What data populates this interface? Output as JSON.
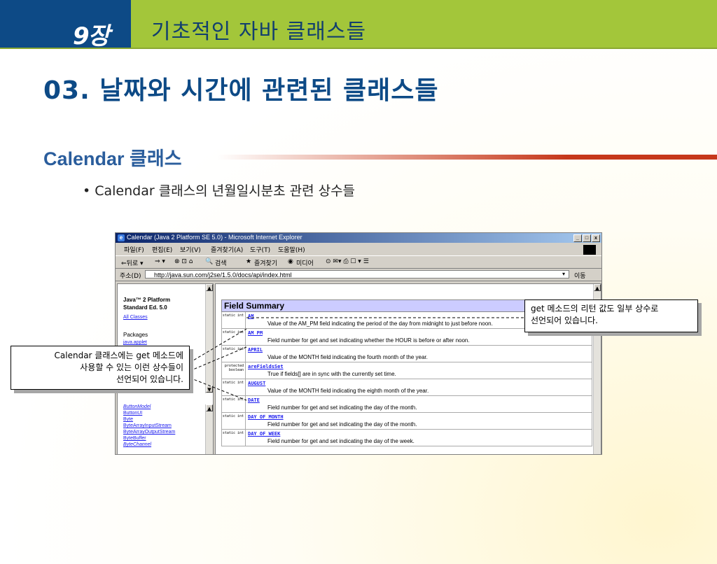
{
  "header": {
    "chapter_num": "9장",
    "chapter_title": "기초적인 자바 클래스들"
  },
  "slide": {
    "title": "03. 날짜와 시간에 관련된 클래스들",
    "subtitle": "Calendar 클래스",
    "bullet": "• Calendar 클래스의 년월일시분초 관련 상수들"
  },
  "browser": {
    "title": "Calendar (Java 2 Platform SE 5.0) - Microsoft Internet Explorer",
    "menu": [
      "파일(F)",
      "편집(E)",
      "보기(V)",
      "즐겨찾기(A)",
      "도구(T)",
      "도움말(H)"
    ],
    "toolbar": {
      "back": "⇐뒤로 ▾",
      "fwd": "⇒ ▾",
      "search": "검색",
      "favorites": "즐겨찾기",
      "media": "미디어"
    },
    "address_label": "주소(D)",
    "address_value": "http://java.sun.com/j2se/1.5.0/docs/api/index.html",
    "go_label": "이동",
    "win_buttons": {
      "min": "_",
      "max": "□",
      "close": "x"
    },
    "left_frame": {
      "title1": "Java™ 2 Platform",
      "title2": "Standard Ed. 5.0",
      "all_classes": "All Classes",
      "packages": "Packages",
      "pkg1": "java.applet",
      "classes": [
        "ButtonModel",
        "ButtonUI",
        "Byte",
        "ByteArrayInputStream",
        "ByteArrayOutputStream",
        "ByteBuffer",
        "ByteChannel"
      ]
    },
    "field_summary": "Field Summary",
    "fields": [
      {
        "mod": "static int",
        "name": "AM",
        "desc": "Value of the AM_PM field indicating the period of the day from midnight to just before noon."
      },
      {
        "mod": "static int",
        "name": "AM_PM",
        "desc": "Field number for get and set indicating whether the HOUR is before or after noon."
      },
      {
        "mod": "static int",
        "name": "APRIL",
        "desc": "Value of the MONTH field indicating the fourth month of the year."
      },
      {
        "mod": "protected boolean",
        "name": "areFieldsSet",
        "desc": "True if fields[] are in sync with the currently set time."
      },
      {
        "mod": "static int",
        "name": "AUGUST",
        "desc": "Value of the MONTH field indicating the eighth month of the year."
      },
      {
        "mod": "static int",
        "name": "DATE",
        "desc": "Field number for get and set indicating the day of the month."
      },
      {
        "mod": "static int",
        "name": "DAY_OF_MONTH",
        "desc": "Field number for get and set indicating the day of the month."
      },
      {
        "mod": "static int",
        "name": "DAY_OF_WEEK",
        "desc": "Field number for get and set indicating the day of the week."
      }
    ]
  },
  "callouts": {
    "right_l1": "get 메소드의 리턴 값도 일부 상수로",
    "right_l2": "선언되어 있습니다.",
    "left_l1": "Calendar 클래스에는 get 메소드에",
    "left_l2": "사용할 수 있는 이런 상수들이",
    "left_l3": "선언되어 있습니다."
  }
}
